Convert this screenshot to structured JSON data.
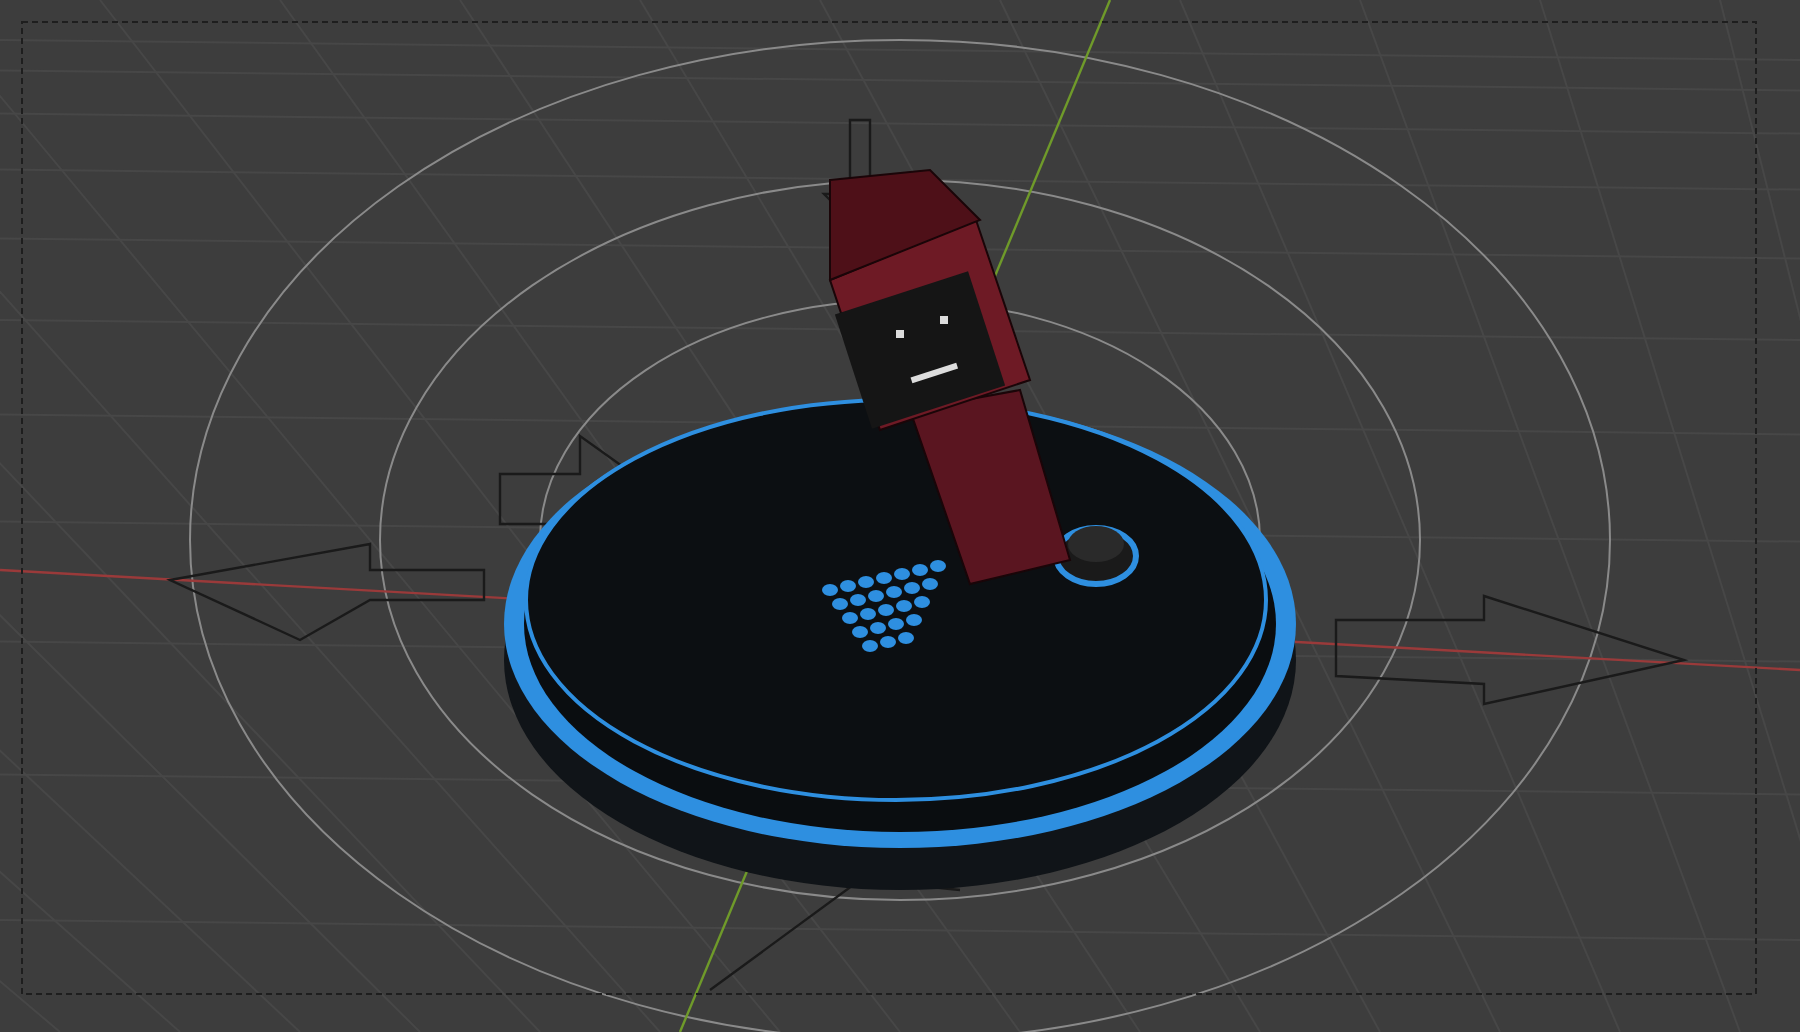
{
  "viewport": {
    "kind": "scene",
    "camera_frame": true
  }
}
